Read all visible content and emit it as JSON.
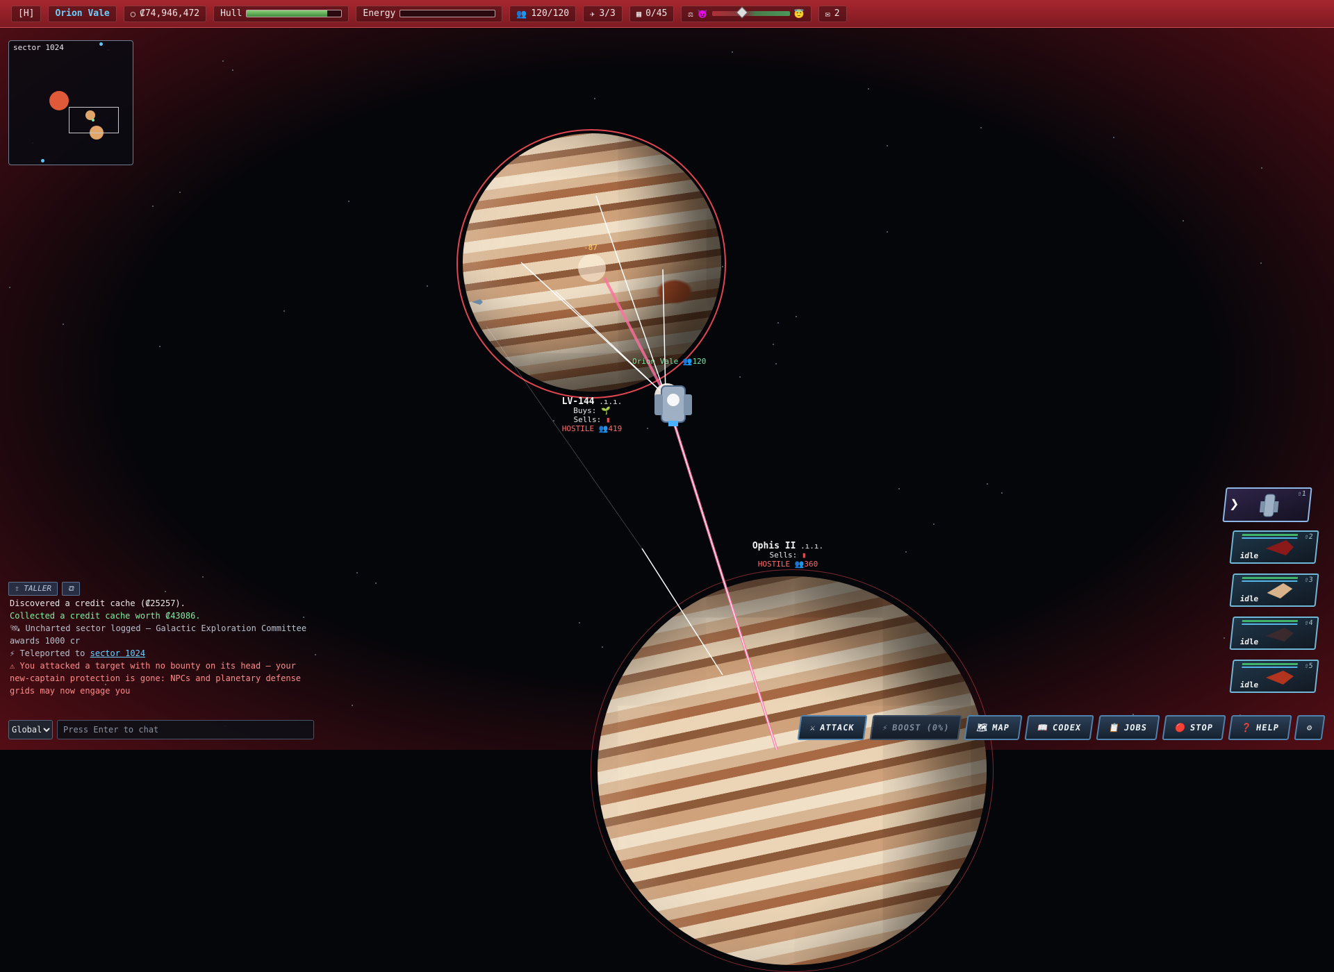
{
  "topbar": {
    "hotkey": "[H]",
    "player_name": "Orion Vale",
    "credits_icon": "coin-icon",
    "credits": "₡74,946,472",
    "hull_label": "Hull",
    "hull_fraction": 0.85,
    "energy_label": "Energy",
    "energy_fraction": 0.0,
    "crew": "120/120",
    "fleet": "3/3",
    "cargo": "0/45",
    "reputation_fraction": 0.38,
    "mail_count": "2"
  },
  "minimap": {
    "sector_label": "sector 1024"
  },
  "world": {
    "damage_number": "-87",
    "player_tag": "Orion Vale",
    "player_crew": "120",
    "planets": [
      {
        "name": "LV-144",
        "signal": ".ı.ı.",
        "buys_label": "Buys:",
        "sells_label": "Sells:",
        "status": "HOSTILE",
        "population": "419"
      },
      {
        "name": "Ophis II",
        "signal": ".ı.ı.",
        "sells_label": "Sells:",
        "status": "HOSTILE",
        "population": "360"
      }
    ]
  },
  "fleet": {
    "lead_number": "1",
    "slots": [
      {
        "number": "2",
        "status": "idle"
      },
      {
        "number": "3",
        "status": "idle"
      },
      {
        "number": "4",
        "status": "idle"
      },
      {
        "number": "5",
        "status": "idle"
      }
    ]
  },
  "log": {
    "tabs": [
      "TALLER",
      "⧉"
    ],
    "lines": [
      {
        "text": "Discovered a credit cache (₡25257).",
        "color": "#e8e8e8"
      },
      {
        "text": "Collected a credit cache worth ₡43086.",
        "color": "#7ff0a0"
      },
      {
        "text": "🛰 Uncharted sector logged — Galactic Exploration Committee awards 1000 cr",
        "color": "#b8c0cc"
      },
      {
        "text": "⚡ Teleported to ",
        "link": "sector 1024",
        "color": "#b8c0cc"
      },
      {
        "text": "⚠ You attacked a target with no bounty on its head — your new-captain protection is gone: NPCs and planetary defense grids may now engage you",
        "color": "#ff8a8a"
      }
    ]
  },
  "chat": {
    "channel": "Global",
    "placeholder": "Press Enter to chat"
  },
  "actions": [
    {
      "label": "ATTACK",
      "icon": "⚔",
      "disabled": false
    },
    {
      "label": "BOOST (0%)",
      "icon": "⚡",
      "disabled": true
    },
    {
      "label": "MAP",
      "icon": "🗺",
      "disabled": false
    },
    {
      "label": "CODEX",
      "icon": "📖",
      "disabled": false
    },
    {
      "label": "JOBS",
      "icon": "📋",
      "disabled": false
    },
    {
      "label": "STOP",
      "icon": "🔴",
      "disabled": false
    },
    {
      "label": "HELP",
      "icon": "❓",
      "disabled": false
    },
    {
      "label": "",
      "icon": "⚙",
      "disabled": false
    }
  ],
  "colors": {
    "accent": "#6ad0ff",
    "hostile": "#ff6a6a",
    "frame": "#a8262e",
    "positive": "#7ff0a0"
  }
}
